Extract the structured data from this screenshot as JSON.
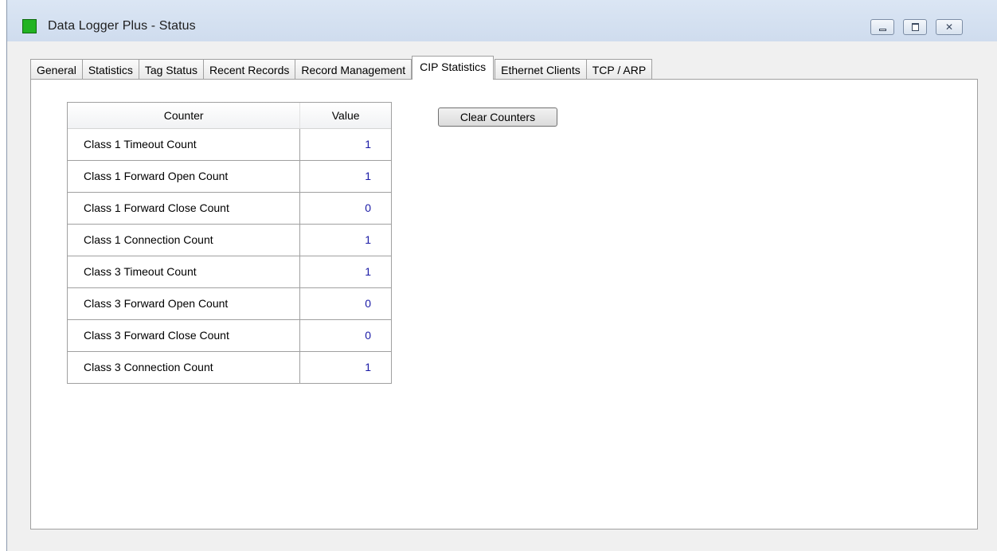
{
  "window": {
    "title": "Data Logger Plus - Status",
    "icon": "green-square-icon",
    "controls": {
      "minimize": "minimize-icon",
      "maximize": "maximize-icon",
      "close": "close-icon",
      "close_glyph": "✕"
    }
  },
  "tabs": [
    {
      "label": "General",
      "active": false
    },
    {
      "label": "Statistics",
      "active": false
    },
    {
      "label": "Tag Status",
      "active": false
    },
    {
      "label": "Recent Records",
      "active": false
    },
    {
      "label": "Record Management",
      "active": false
    },
    {
      "label": "CIP Statistics",
      "active": true
    },
    {
      "label": "Ethernet Clients",
      "active": false
    },
    {
      "label": "TCP / ARP",
      "active": false
    }
  ],
  "grid": {
    "headers": {
      "counter": "Counter",
      "value": "Value"
    },
    "rows": [
      {
        "counter": "Class 1 Timeout Count",
        "value": "1"
      },
      {
        "counter": "Class 1 Forward Open Count",
        "value": "1"
      },
      {
        "counter": "Class 1 Forward Close Count",
        "value": "0"
      },
      {
        "counter": "Class 1 Connection Count",
        "value": "1"
      },
      {
        "counter": "Class 3 Timeout Count",
        "value": "1"
      },
      {
        "counter": "Class 3 Forward Open Count",
        "value": "0"
      },
      {
        "counter": "Class 3 Forward Close Count",
        "value": "0"
      },
      {
        "counter": "Class 3 Connection Count",
        "value": "1"
      }
    ]
  },
  "buttons": {
    "clear_counters": "Clear Counters"
  },
  "colors": {
    "title_icon": "#22b322",
    "value_text": "#1a1aa6"
  }
}
